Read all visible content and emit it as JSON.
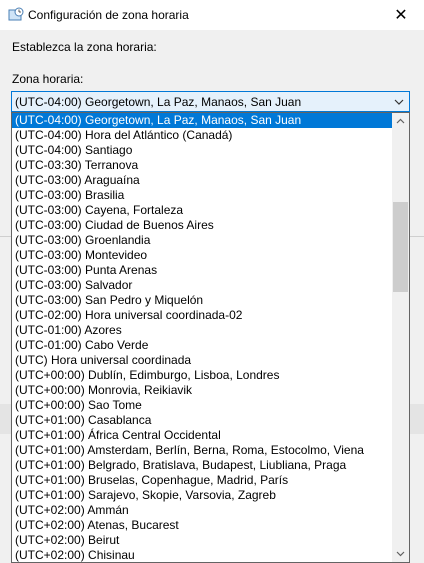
{
  "window": {
    "title": "Configuración de zona horaria",
    "close_glyph": "✕",
    "app_icon": "clock-globe-icon"
  },
  "dialog": {
    "instruction": "Establezca la zona horaria:",
    "timezone_label": "Zona horaria:",
    "selected_value": "(UTC-04:00) Georgetown, La Paz, Manaos, San Juan"
  },
  "dropdown": {
    "selected_index": 0,
    "scroll_position_fraction": 0.22,
    "items": [
      "(UTC-04:00) Georgetown, La Paz, Manaos, San Juan",
      "(UTC-04:00) Hora del Atlántico (Canadá)",
      "(UTC-04:00) Santiago",
      "(UTC-03:30) Terranova",
      "(UTC-03:00) Araguaína",
      "(UTC-03:00) Brasilia",
      "(UTC-03:00) Cayena, Fortaleza",
      "(UTC-03:00) Ciudad de Buenos Aires",
      "(UTC-03:00) Groenlandia",
      "(UTC-03:00) Montevideo",
      "(UTC-03:00) Punta Arenas",
      "(UTC-03:00) Salvador",
      "(UTC-03:00) San Pedro y Miquelón",
      "(UTC-02:00) Hora universal coordinada-02",
      "(UTC-01:00) Azores",
      "(UTC-01:00) Cabo Verde",
      "(UTC) Hora universal coordinada",
      "(UTC+00:00) Dublín, Edimburgo, Lisboa, Londres",
      "(UTC+00:00) Monrovia, Reikiavik",
      "(UTC+00:00) Sao Tome",
      "(UTC+01:00) Casablanca",
      "(UTC+01:00) África Central Occidental",
      "(UTC+01:00) Amsterdam, Berlín, Berna, Roma, Estocolmo, Viena",
      "(UTC+01:00) Belgrado, Bratislava, Budapest, Liubliana, Praga",
      "(UTC+01:00) Bruselas, Copenhague, Madrid, París",
      "(UTC+01:00) Sarajevo, Skopie, Varsovia, Zagreb",
      "(UTC+02:00) Ammán",
      "(UTC+02:00) Atenas, Bucarest",
      "(UTC+02:00) Beirut",
      "(UTC+02:00) Chisinau"
    ]
  },
  "colors": {
    "selection": "#0078d7",
    "dialog_bg": "#f0f0f0",
    "list_border": "#646464"
  }
}
